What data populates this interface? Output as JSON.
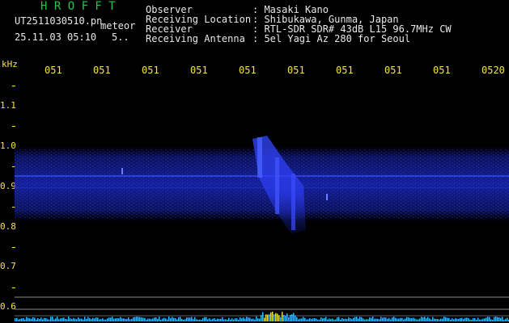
{
  "brand": "H R O F F T",
  "file_name": "UT2511030510.pn",
  "file_tag": "meteor",
  "datetime": "25.11.03 05:10",
  "datetime_extra": "5..",
  "info": [
    {
      "label": "Observer",
      "value": ": Masaki Kano"
    },
    {
      "label": "Receiving Location",
      "value": ": Shibukawa, Gunma, Japan"
    },
    {
      "label": "Receiver",
      "value": ": RTL-SDR SDR# 43dB L15 96.7MHz CW"
    },
    {
      "label": "Receiving Antenna",
      "value": ": 5el Yagi Az 280 for Seoul"
    }
  ],
  "y_axis_unit": "kHz",
  "time_ticks": [
    "051",
    "051",
    "051",
    "051",
    "051",
    "051",
    "051",
    "051",
    "051",
    "0520"
  ],
  "freq_ticks": [
    "1.1",
    "1.0",
    "0.9",
    "0.8",
    "0.7",
    "0.6"
  ],
  "colors": {
    "background": "#000000",
    "signal": "#3a4cff",
    "axis": "#f4e24a",
    "brand": "#21c64a"
  }
}
